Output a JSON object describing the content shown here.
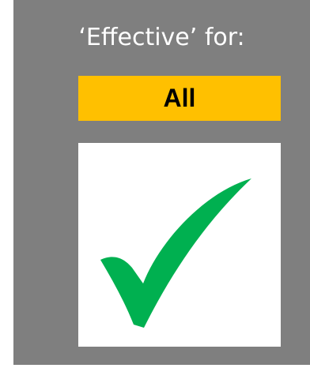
{
  "panel": {
    "title": "‘Effective’ for:",
    "badge_label": "All",
    "badge_color": "#ffc000",
    "background_color": "#7f7f7f",
    "check_icon": "checkmark-icon",
    "check_color": "#00b050"
  }
}
